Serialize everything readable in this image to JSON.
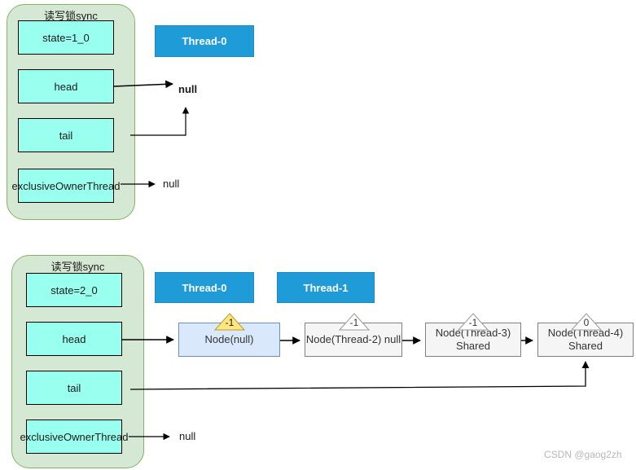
{
  "watermark": "CSDN @gaog2zh",
  "sections": [
    {
      "id": "section-1",
      "sync": {
        "title": "读写锁sync",
        "fields": [
          {
            "name": "state",
            "label": "state=1_0"
          },
          {
            "name": "head",
            "label": "head"
          },
          {
            "name": "tail",
            "label": "tail"
          },
          {
            "name": "exclusiveOwnerThread",
            "label": "exclusiveOwnerThread"
          }
        ]
      },
      "threads": [
        {
          "label": "Thread-0"
        }
      ],
      "labels": {
        "head_target": "null",
        "tail_target": "null",
        "owner_target": "null"
      },
      "nodes": []
    },
    {
      "id": "section-2",
      "sync": {
        "title": "读写锁sync",
        "fields": [
          {
            "name": "state",
            "label": "state=2_0"
          },
          {
            "name": "head",
            "label": "head"
          },
          {
            "name": "tail",
            "label": "tail"
          },
          {
            "name": "exclusiveOwnerThread",
            "label": "exclusiveOwnerThread"
          }
        ]
      },
      "threads": [
        {
          "label": "Thread-0"
        },
        {
          "label": "Thread-1"
        }
      ],
      "labels": {
        "owner_target": "null"
      },
      "nodes": [
        {
          "label": "Node(null)",
          "waitStatus": "-1",
          "badge_style": "yellow",
          "style": "head-node"
        },
        {
          "label": "Node(Thread-2) null",
          "waitStatus": "-1",
          "badge_style": "plain",
          "style": "plain-node"
        },
        {
          "label": "Node(Thread-3)\nShared",
          "waitStatus": "-1",
          "badge_style": "plain",
          "style": "plain-node"
        },
        {
          "label": "Node(Thread-4)\nShared",
          "waitStatus": "0",
          "badge_style": "plain",
          "style": "plain-node"
        }
      ]
    }
  ],
  "colors": {
    "sync_fill": "#d5e8d4",
    "sync_stroke": "#82b366",
    "field_fill": "#99ffee",
    "field_stroke": "#000000",
    "thread_fill": "#1f9bd8",
    "head_node_fill": "#dae8fc",
    "head_node_stroke": "#6c8ebf",
    "node_fill": "#f5f5f5",
    "node_stroke": "#808080",
    "badge_yellow": "#ffe680",
    "arrow": "#000000"
  }
}
